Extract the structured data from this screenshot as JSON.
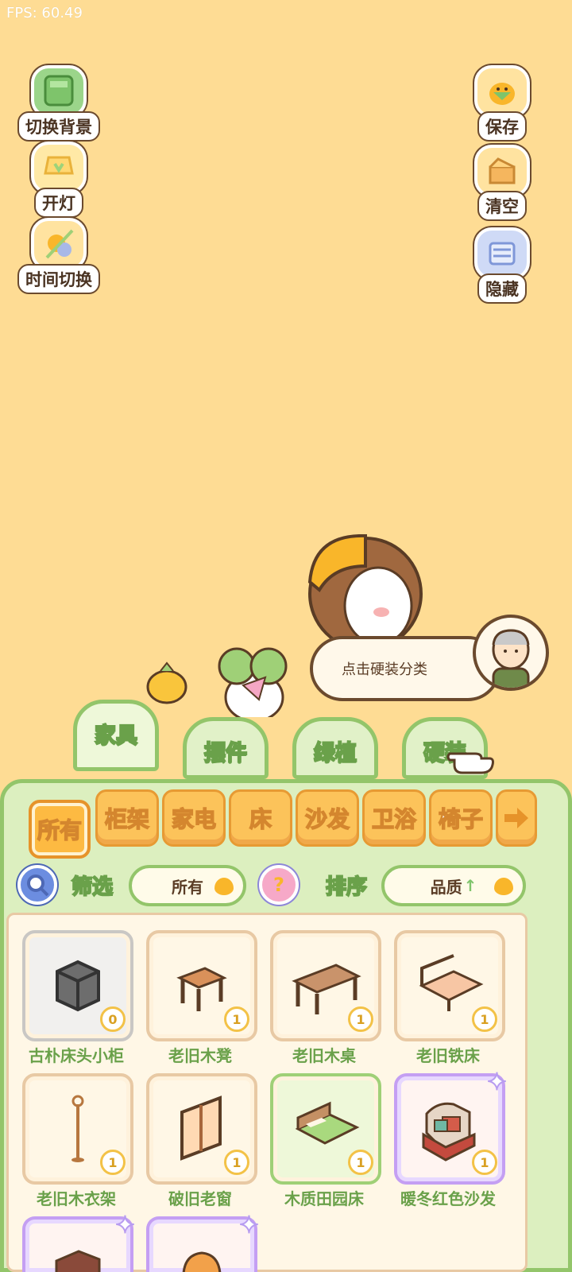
{
  "fps": "FPS: 60.49",
  "left_tools": [
    {
      "label": "切换背景",
      "icon": "background-icon"
    },
    {
      "label": "开灯",
      "icon": "lamp-icon"
    },
    {
      "label": "时间切换",
      "icon": "sun-moon-icon"
    }
  ],
  "right_tools": [
    {
      "label": "保存",
      "icon": "save-duck-icon"
    },
    {
      "label": "清空",
      "icon": "clear-box-icon"
    },
    {
      "label": "隐藏",
      "icon": "hide-icon"
    }
  ],
  "speech": "点击硬装分类",
  "category_tabs": [
    "家具",
    "摆件",
    "绿植",
    "硬装"
  ],
  "sub_tabs": [
    "所有",
    "柜架",
    "家电",
    "床",
    "沙发",
    "卫浴",
    "椅子"
  ],
  "filter": {
    "label": "筛选",
    "value": "所有"
  },
  "sort": {
    "label": "排序",
    "value": "品质",
    "arrow": "↑"
  },
  "items": [
    {
      "name": "古朴床头小柜",
      "qty": "0"
    },
    {
      "name": "老旧木凳",
      "qty": "1"
    },
    {
      "name": "老旧木桌",
      "qty": "1"
    },
    {
      "name": "老旧铁床",
      "qty": "1"
    },
    {
      "name": "老旧木衣架",
      "qty": "1"
    },
    {
      "name": "破旧老窗",
      "qty": "1"
    },
    {
      "name": "木质田园床",
      "qty": "1"
    },
    {
      "name": "暖冬红色沙发",
      "qty": "1"
    }
  ],
  "colors": {
    "background": "#fedc94",
    "panel": "#dcefbf",
    "accent_green": "#93c56a",
    "tab_orange": "#fcc35a"
  }
}
